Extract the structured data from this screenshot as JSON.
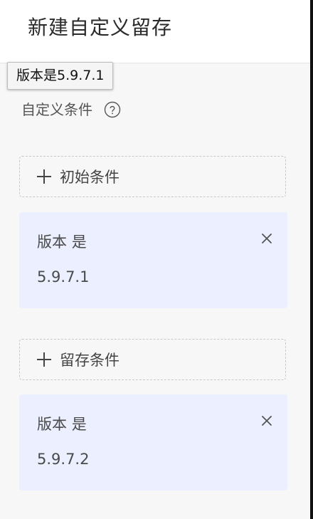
{
  "header": {
    "title": "新建自定义留存"
  },
  "tooltip": {
    "text": "版本是5.9.7.1"
  },
  "section": {
    "label": "自定义条件",
    "help_icon": "help-circle-icon"
  },
  "initial": {
    "add_label": "初始条件",
    "condition": {
      "field": "版本",
      "operator": "是",
      "value": "5.9.7.1"
    }
  },
  "retention": {
    "add_label": "留存条件",
    "condition": {
      "field": "版本",
      "operator": "是",
      "value": "5.9.7.2"
    }
  },
  "colors": {
    "card_bg": "#ebefff",
    "page_bg": "#f7f7f8",
    "dashed_border": "#c9c9c9"
  }
}
